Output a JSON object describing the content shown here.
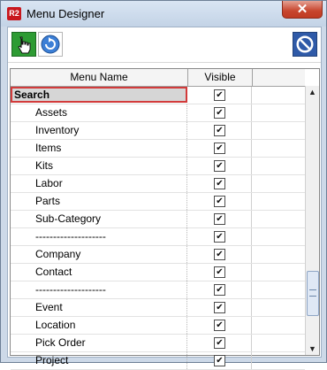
{
  "window": {
    "title": "Menu Designer",
    "app_icon_text": "R2",
    "close_glyph": "✕"
  },
  "table": {
    "col_name": "Menu Name",
    "col_visible": "Visible",
    "rows": [
      {
        "label": "Search",
        "visible": true,
        "group": true
      },
      {
        "label": "Assets",
        "visible": true
      },
      {
        "label": "Inventory",
        "visible": true
      },
      {
        "label": "Items",
        "visible": true
      },
      {
        "label": "Kits",
        "visible": true
      },
      {
        "label": "Labor",
        "visible": true
      },
      {
        "label": "Parts",
        "visible": true
      },
      {
        "label": "Sub-Category",
        "visible": true
      },
      {
        "label": "--------------------",
        "visible": true
      },
      {
        "label": "Company",
        "visible": true
      },
      {
        "label": "Contact",
        "visible": true
      },
      {
        "label": "--------------------",
        "visible": true
      },
      {
        "label": "Event",
        "visible": true
      },
      {
        "label": "Location",
        "visible": true
      },
      {
        "label": "Pick Order",
        "visible": true
      },
      {
        "label": "Project",
        "visible": true
      }
    ]
  },
  "checkmark": "✔",
  "scrollbar": {
    "up": "▲",
    "down": "▼"
  }
}
